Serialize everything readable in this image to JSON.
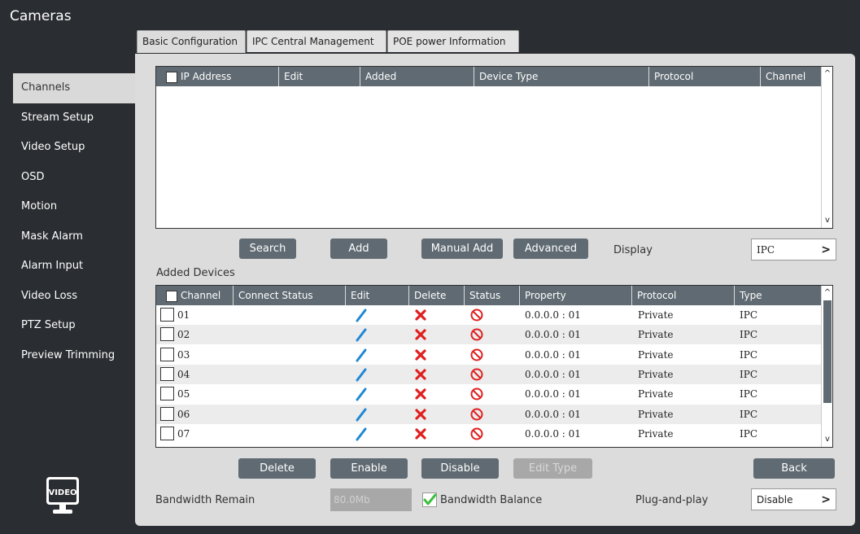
{
  "app": {
    "title": "Cameras"
  },
  "sidebar": {
    "items": [
      {
        "label": "Channels",
        "active": true
      },
      {
        "label": "Stream Setup"
      },
      {
        "label": "Video Setup"
      },
      {
        "label": "OSD"
      },
      {
        "label": "Motion"
      },
      {
        "label": "Mask Alarm"
      },
      {
        "label": "Alarm Input"
      },
      {
        "label": "Video Loss"
      },
      {
        "label": "PTZ Setup"
      },
      {
        "label": "Preview Trimming"
      }
    ],
    "logo_text": "VIDEO"
  },
  "tabs": [
    {
      "label": "Basic Configuration",
      "active": true
    },
    {
      "label": "IPC Central Management"
    },
    {
      "label": "POE power Information"
    }
  ],
  "search_table": {
    "columns": [
      "IP Address",
      "Edit",
      "Added",
      "Device Type",
      "Protocol",
      "Channel"
    ]
  },
  "search_buttons": {
    "search": "Search",
    "add": "Add",
    "manual_add": "Manual Add",
    "advanced": "Advanced"
  },
  "display": {
    "label": "Display",
    "value": "IPC"
  },
  "added_devices": {
    "title": "Added Devices",
    "columns": [
      "Channel",
      "Connect Status",
      "Edit",
      "Delete",
      "Status",
      "Property",
      "Protocol",
      "Type"
    ],
    "rows": [
      {
        "channel": "01",
        "property": "0.0.0.0 : 01",
        "protocol": "Private",
        "type": "IPC"
      },
      {
        "channel": "02",
        "property": "0.0.0.0 : 01",
        "protocol": "Private",
        "type": "IPC"
      },
      {
        "channel": "03",
        "property": "0.0.0.0 : 01",
        "protocol": "Private",
        "type": "IPC"
      },
      {
        "channel": "04",
        "property": "0.0.0.0 : 01",
        "protocol": "Private",
        "type": "IPC"
      },
      {
        "channel": "05",
        "property": "0.0.0.0 : 01",
        "protocol": "Private",
        "type": "IPC"
      },
      {
        "channel": "06",
        "property": "0.0.0.0 : 01",
        "protocol": "Private",
        "type": "IPC"
      },
      {
        "channel": "07",
        "property": "0.0.0.0 : 01",
        "protocol": "Private",
        "type": "IPC"
      }
    ]
  },
  "bottom_buttons": {
    "delete": "Delete",
    "enable": "Enable",
    "disable": "Disable",
    "edit_type": "Edit Type",
    "back": "Back"
  },
  "bandwidth": {
    "remain_label": "Bandwidth Remain",
    "remain_value": "80.0Mb",
    "balance_label": "Bandwidth Balance",
    "balance_checked": true
  },
  "plug_and_play": {
    "label": "Plug-and-play",
    "value": "Disable"
  },
  "colors": {
    "background": "#2a2d31",
    "panel": "#dcdcdc",
    "header": "#5f6a72",
    "edit_icon": "#1e88d6",
    "delete_icon": "#e02020",
    "status_icon": "#e02020",
    "check_icon": "#3cc03c"
  },
  "icons": {
    "edit": "pencil-icon",
    "delete": "x-icon",
    "status": "prohibited-icon",
    "arrow": "chevron-right-icon",
    "check": "checkmark-icon"
  }
}
